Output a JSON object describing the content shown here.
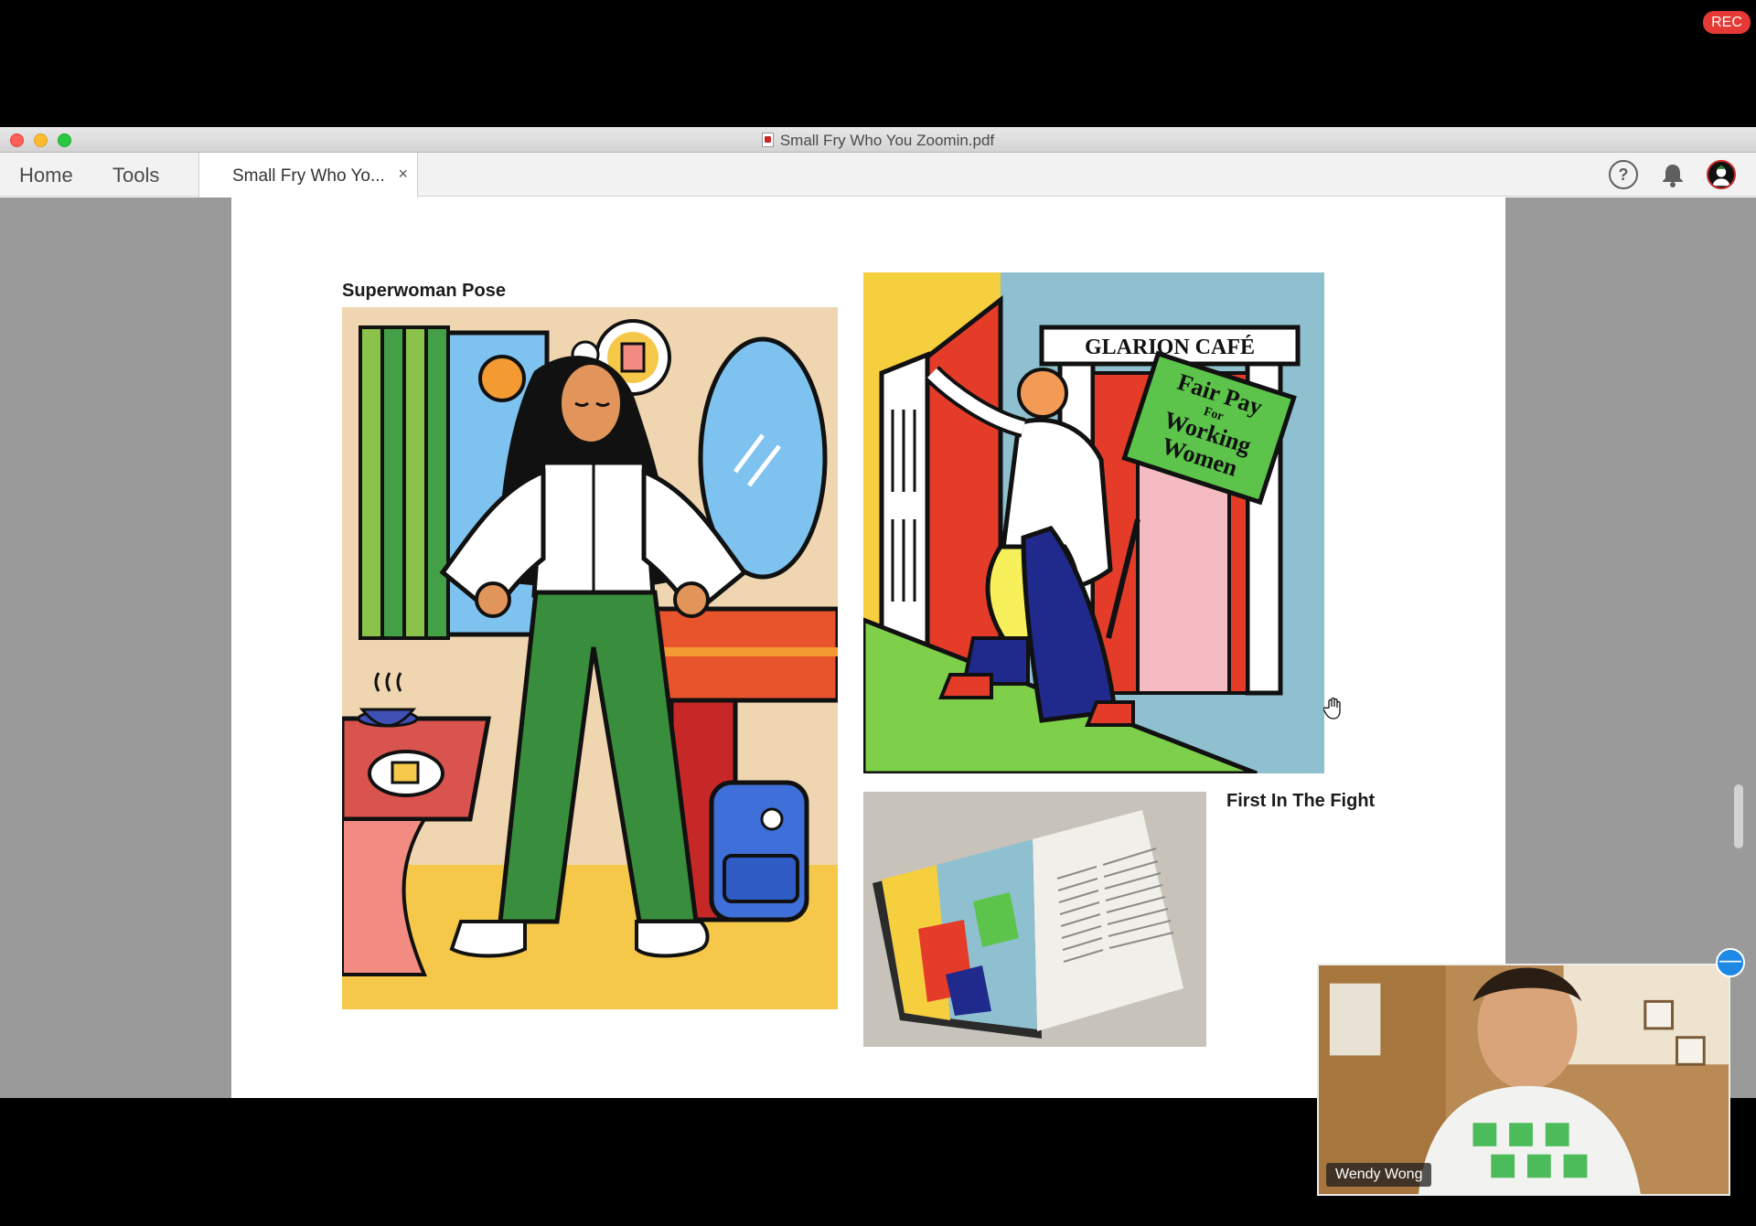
{
  "recording_badge": "REC",
  "window": {
    "title": "Small Fry Who You Zoomin.pdf"
  },
  "toolbar": {
    "home_label": "Home",
    "tools_label": "Tools",
    "tab_label": "Small Fry Who Yo...",
    "tab_close": "×",
    "help_glyph": "?"
  },
  "document": {
    "caption_left": "Superwoman Pose",
    "caption_right": "First In The Fight",
    "sign_cafe": "GLARION CAFÉ",
    "sign_protest": [
      "Fair Pay",
      "For",
      "Working",
      "Women"
    ]
  },
  "video": {
    "participant_name": "Wendy Wong",
    "minimize_glyph": "—"
  },
  "icons": {
    "help": "help-icon",
    "bell": "bell-icon",
    "avatar": "user-avatar",
    "cursor": "hand-cursor-icon"
  }
}
